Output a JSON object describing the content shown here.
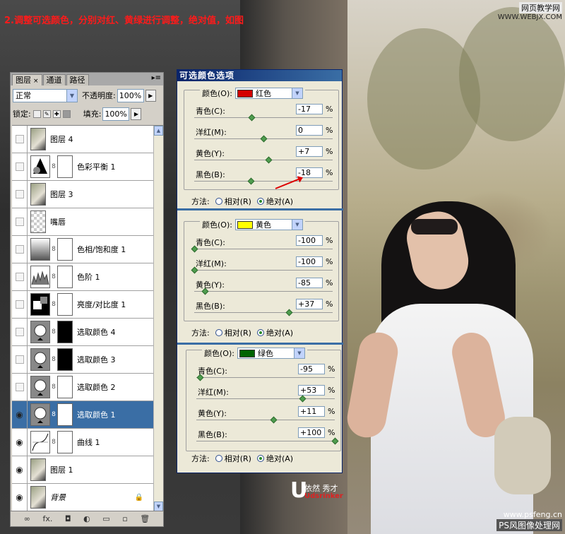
{
  "caption": "2.调整可选颜色，分别对红、黄绿进行调整，绝对值，如图",
  "watermark": {
    "top_line1": "网页教学网",
    "top_line2": "WWW.WEBJX.COM",
    "bottom_line1": "www.psfeng.cn",
    "bottom_line2": "PS风图像处理网",
    "logo_letter": "U",
    "logo_name": "依然 秀才",
    "logo_sub": "Udsrinker"
  },
  "layers_panel": {
    "tabs": [
      {
        "label": "图层",
        "close": "×"
      },
      {
        "label": "通道"
      },
      {
        "label": "路径"
      }
    ],
    "blend_mode": "正常",
    "opacity_label": "不透明度:",
    "opacity_value": "100%",
    "lock_label": "锁定:",
    "fill_label": "填充:",
    "fill_value": "100%",
    "layers": [
      {
        "name": "图层 4",
        "visible": false
      },
      {
        "name": "色彩平衡 1",
        "visible": false
      },
      {
        "name": "图层 3",
        "visible": false
      },
      {
        "name": "嘴唇",
        "visible": false
      },
      {
        "name": "色相/饱和度 1",
        "visible": false
      },
      {
        "name": "色阶 1",
        "visible": false
      },
      {
        "name": "亮度/对比度 1",
        "visible": false
      },
      {
        "name": "选取颜色 4",
        "visible": false
      },
      {
        "name": "选取颜色 3",
        "visible": false
      },
      {
        "name": "选取颜色 2",
        "visible": false
      },
      {
        "name": "选取颜色 1",
        "visible": true,
        "selected": true
      },
      {
        "name": "曲线 1",
        "visible": true
      },
      {
        "name": "图层 1",
        "visible": true
      },
      {
        "name": "背景",
        "visible": true
      }
    ],
    "bottom_icons": [
      "link-icon",
      "fx-icon",
      "mask-icon",
      "adjustment-icon",
      "folder-icon",
      "new-layer-icon",
      "trash-icon"
    ],
    "bottom_labels": [
      "∞",
      "fx.",
      "◘",
      "◐",
      "▭",
      "▫",
      "🗑"
    ]
  },
  "dialog": {
    "title": "可选颜色选项",
    "color_label": "颜色(O):",
    "cyan_label": "青色(C):",
    "magenta_label": "洋红(M):",
    "yellow_label": "黄色(Y):",
    "black_label": "黑色(B):",
    "method_label": "方法:",
    "relative_label": "相对(R)",
    "absolute_label": "绝对(A)",
    "percent": "%",
    "sections": [
      {
        "color_name": "红色",
        "swatch": "#d40000",
        "cyan": "-17",
        "magenta": "0",
        "yellow": "+7",
        "black": "-18"
      },
      {
        "color_name": "黄色",
        "swatch": "#ffff00",
        "cyan": "-100",
        "magenta": "-100",
        "yellow": "-85",
        "black": "+37"
      },
      {
        "color_name": "绿色",
        "swatch": "#006400",
        "cyan": "-95",
        "magenta": "+53",
        "yellow": "+11",
        "black": "+100"
      }
    ]
  }
}
